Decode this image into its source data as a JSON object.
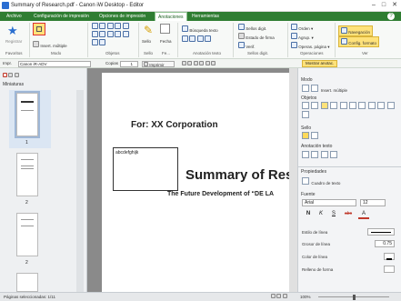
{
  "window": {
    "title": "Summary of Research.pdf - Canon iW Desktop - Editor",
    "minimize": "–",
    "maximize": "□",
    "close": "✕"
  },
  "tabs": [
    {
      "label": "Archivo",
      "active": false
    },
    {
      "label": "Configuración de impresión",
      "active": false
    },
    {
      "label": "Opciones de impresión",
      "active": false
    },
    {
      "label": "Anotaciones",
      "active": true
    },
    {
      "label": "Herramientas",
      "active": false
    }
  ],
  "ribbon": {
    "favoritos": {
      "button": "Registrar",
      "label": "Favoritos"
    },
    "modo": {
      "insert_multiple": "Insert. múltiple",
      "label": "Modo"
    },
    "objetos": {
      "label": "Objetos"
    },
    "sello": {
      "button": "Sello",
      "label": "Sello"
    },
    "fecha": {
      "button": "Fecha",
      "label": "Fe..."
    },
    "anotacion": {
      "search": "Búsqueda texto",
      "label": "Anotación texto"
    },
    "sellos": {
      "digital": "Sellos digit.",
      "estado": "Estado de firma",
      "verif": "Verif.",
      "label": "Sellos digit."
    },
    "operaciones": {
      "orden": "Orden",
      "agrup": "Agrup.",
      "operas_pagina": "Operas. página",
      "label": "Operaciones"
    },
    "ver": {
      "navegacion": "Navegación",
      "config_formato": "Config. formato",
      "label": "Ver"
    }
  },
  "toolbar2": {
    "printer_label": "Impr.",
    "printer_value": "Canon iR-ADV",
    "copies_label": "Copias",
    "copies_value": "1",
    "print_button": "Imprimir",
    "show_annotations": "Mostrar anotac."
  },
  "leftpanel": {
    "title": "Miniaturas",
    "pages": [
      "1",
      "2",
      "2",
      ""
    ]
  },
  "document": {
    "for_text": "For: XX Corporation",
    "box_text": "abcdefghijk",
    "summary_title": "Summary of Res",
    "subtitle": "The Future Development of “DE LA"
  },
  "rightpanel": {
    "modo_header": "Modo",
    "insert_multiple": "Insert. múltiple",
    "objetos_header": "Objetos",
    "sello_header": "Sello",
    "anotacion_header": "Anotación texto",
    "propiedades_header": "Propiedades",
    "cuadro_texto": "Cuadro de texto",
    "fuente_label": "Fuente",
    "font_name": "Arial",
    "font_size": "12",
    "bold": "N",
    "italic": "K",
    "strike": "S",
    "abc": "abc",
    "font_color_letter": "A",
    "estilo_linea": "Estilo de línea",
    "grosor_linea": "Grosor de línea",
    "grosor_value": "0.75",
    "color_linea": "Color de línea",
    "relleno_forma": "Relleno de forma"
  },
  "statusbar": {
    "pages_selected": "Páginas seleccionadas: 1/11",
    "zoom": "100%"
  },
  "colors": {
    "tabbar": "#2f7d32",
    "ribbon_bg": "#f7f9f7",
    "highlight": "#ffe27a",
    "doc_bg": "#8a8a8a"
  }
}
